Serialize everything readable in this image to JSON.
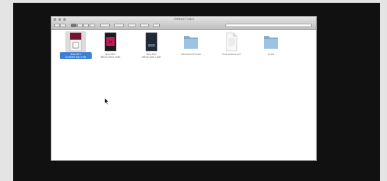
{
  "window": {
    "title": "Untitled Folder"
  },
  "files": [
    {
      "name_line1": "Doc-001",
      "name_line2": "Untitled doc.indd",
      "kind": "indesign-icon",
      "selected": true
    },
    {
      "name_line1": "Doc-002",
      "name_line2": "BRO0-0001.indd",
      "kind": "indesign-icon",
      "selected": false
    },
    {
      "name_line1": "Doc-003",
      "name_line2": "BRO0-0001.pdf",
      "kind": "pdf-icon",
      "selected": false
    },
    {
      "name_line1": "",
      "name_line2": "Document fonts",
      "kind": "folder-icon",
      "selected": false
    },
    {
      "name_line1": "",
      "name_line2": "Instructions.txt",
      "kind": "text-file-icon",
      "selected": false
    },
    {
      "name_line1": "",
      "name_line2": "Links",
      "kind": "folder-icon",
      "selected": false
    }
  ],
  "colors": {
    "selection": "#3b7fd6",
    "folder": "#8fb9da",
    "indesign": "#c2185b",
    "pdf_dark": "#1f2a33"
  }
}
